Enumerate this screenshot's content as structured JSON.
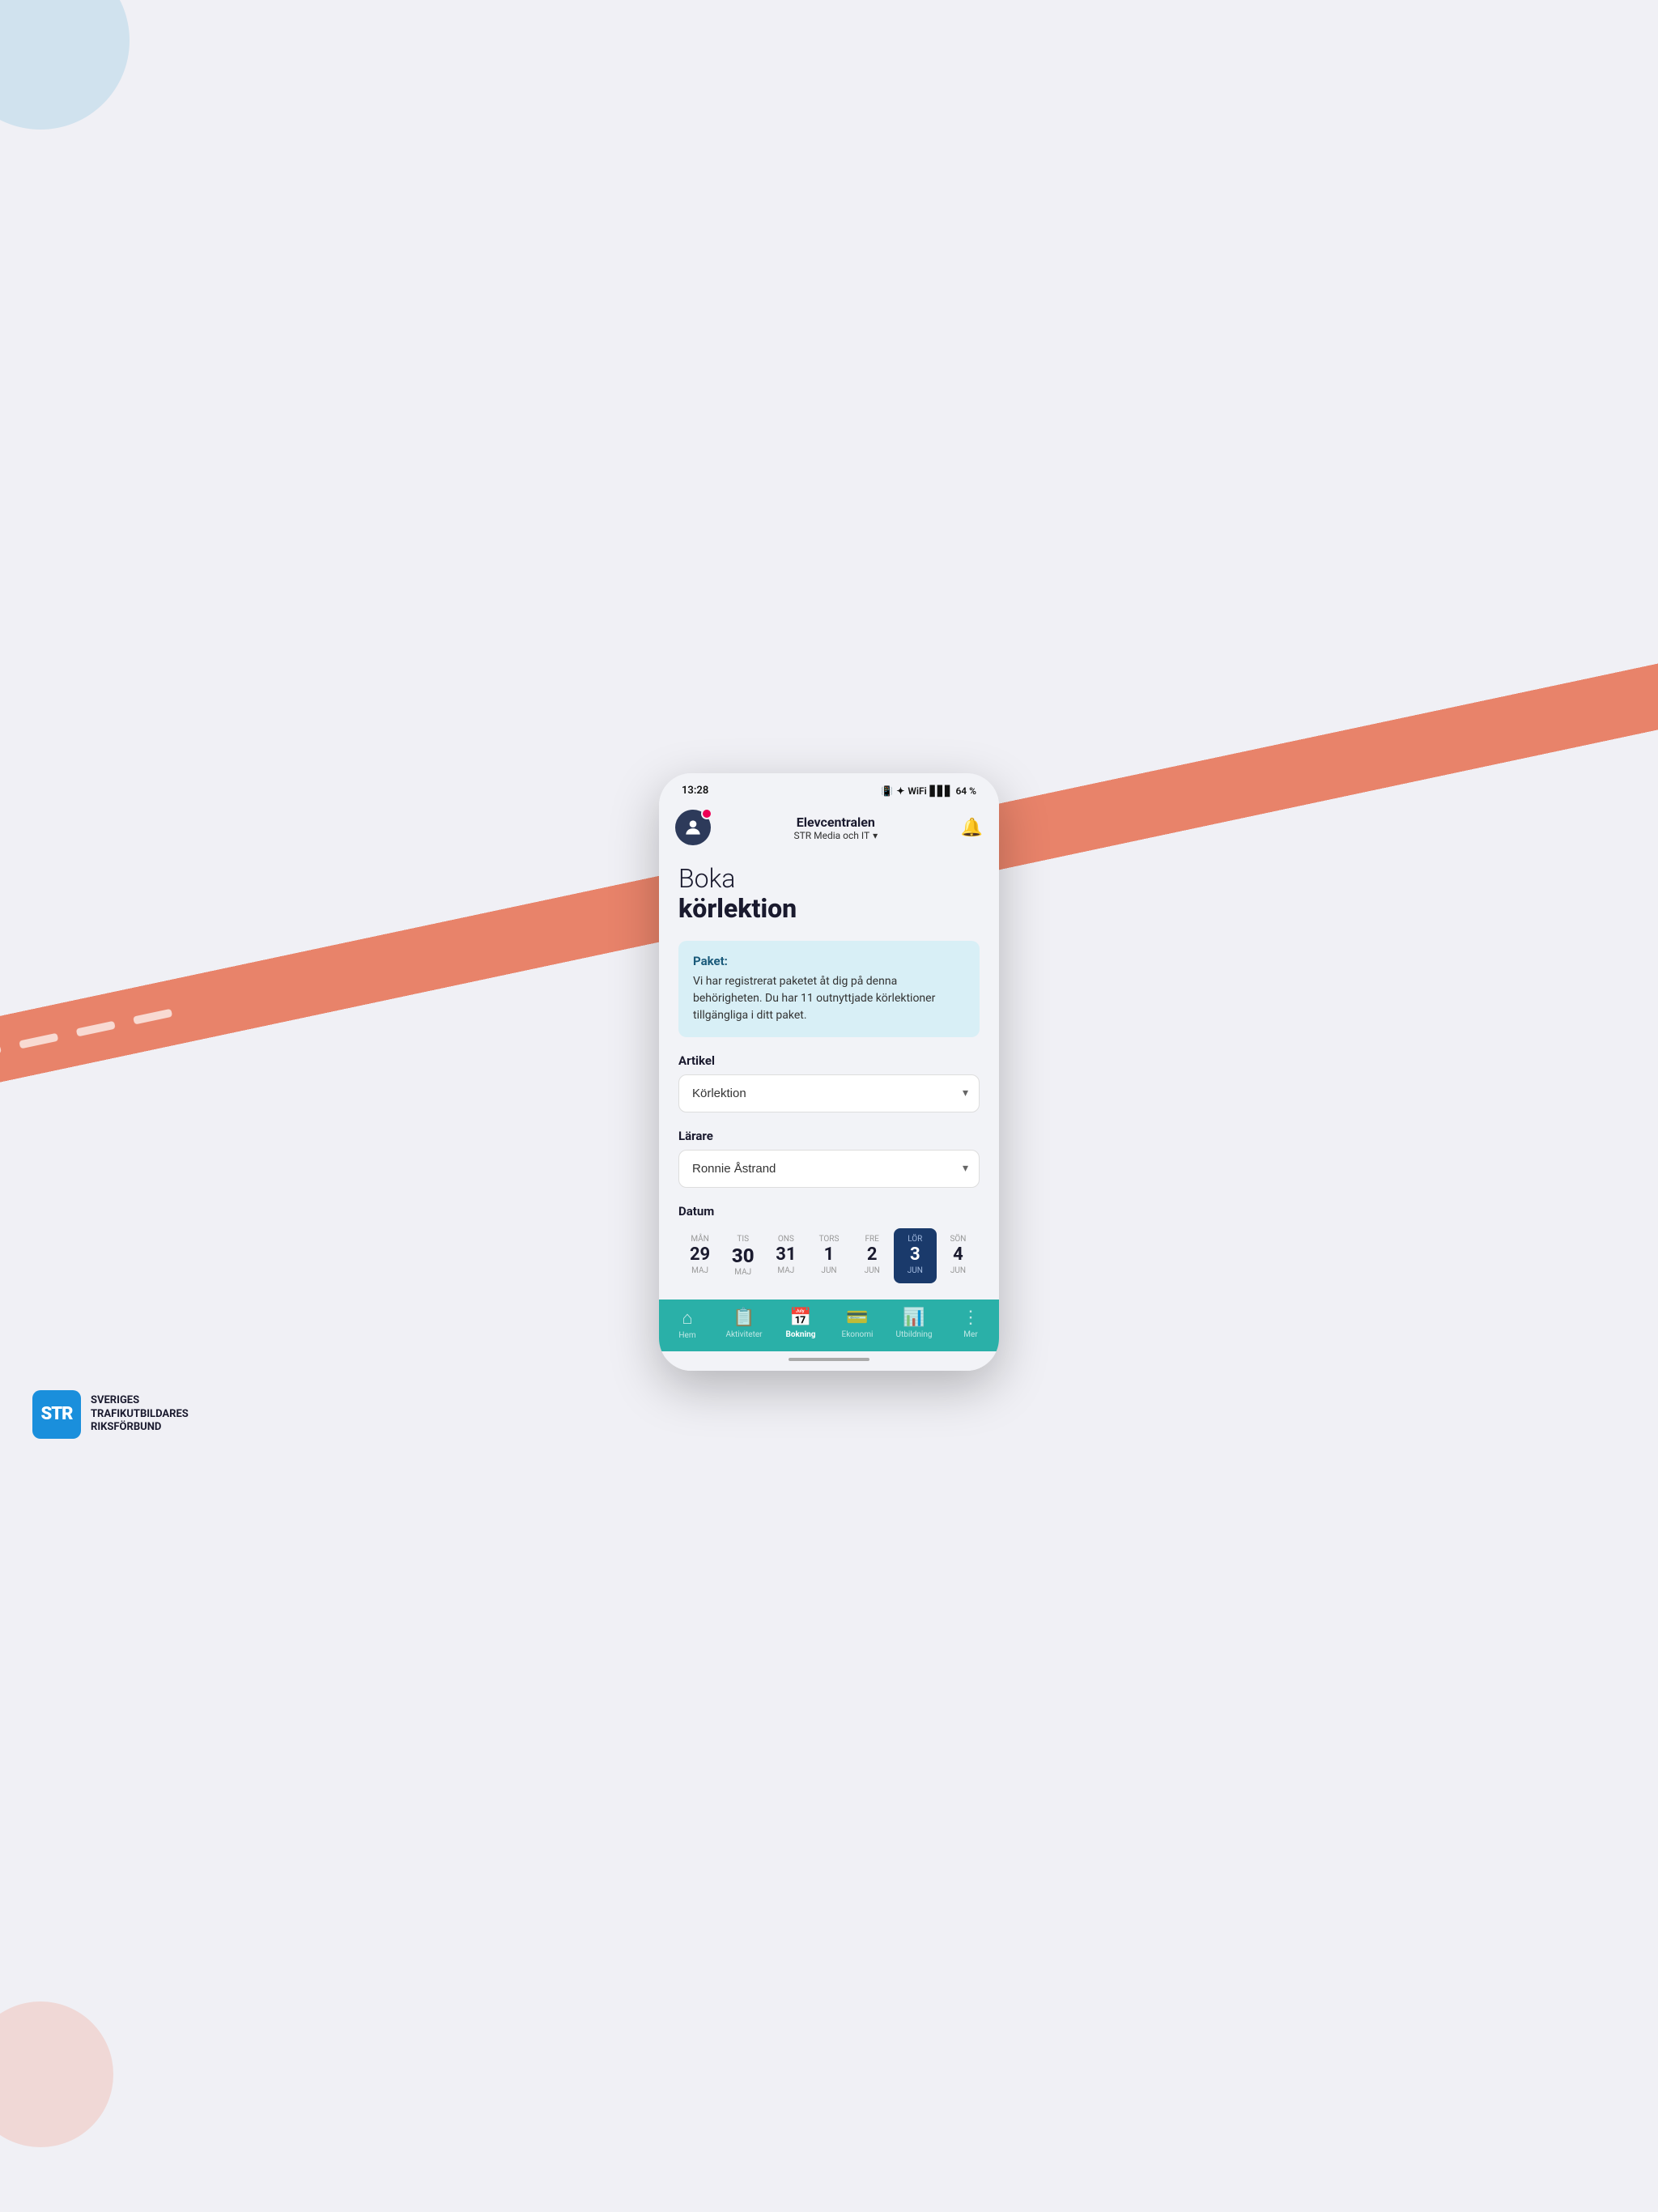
{
  "status_bar": {
    "time": "13:28",
    "battery": "64 %",
    "icons": "🔇 ✦ ⟳ ▋▋▋ 🔋"
  },
  "header": {
    "app_name": "Elevcentralen",
    "subtitle": "STR Media och IT",
    "chevron": "▾"
  },
  "page": {
    "title_light": "Boka",
    "title_bold": "körlektion"
  },
  "info_box": {
    "title": "Paket:",
    "text": "Vi har registrerat paketet åt dig på denna behörigheten. Du har 11 outnyttjade körlektioner tillgängliga i ditt paket."
  },
  "form": {
    "artikel_label": "Artikel",
    "artikel_value": "Körlektion",
    "larare_label": "Lärare",
    "larare_value": "Ronnie Åstrand",
    "datum_label": "Datum"
  },
  "dates": [
    {
      "day": "MÅN",
      "number": "29",
      "month": "MAJ",
      "active": false,
      "highlighted": false
    },
    {
      "day": "TIS",
      "number": "30",
      "month": "MAJ",
      "active": false,
      "highlighted": true
    },
    {
      "day": "ONS",
      "number": "31",
      "month": "MAJ",
      "active": false,
      "highlighted": false
    },
    {
      "day": "TORS",
      "number": "1",
      "month": "JUN",
      "active": false,
      "highlighted": false
    },
    {
      "day": "FRE",
      "number": "2",
      "month": "JUN",
      "active": false,
      "highlighted": false
    },
    {
      "day": "LÖR",
      "number": "3",
      "month": "JUN",
      "active": true,
      "highlighted": false
    },
    {
      "day": "SÖN",
      "number": "4",
      "month": "JUN",
      "active": false,
      "highlighted": false
    }
  ],
  "bottom_nav": [
    {
      "label": "Hem",
      "icon": "⌂",
      "active": false
    },
    {
      "label": "Aktiviteter",
      "icon": "📋",
      "active": false
    },
    {
      "label": "Bokning",
      "icon": "📅",
      "active": true
    },
    {
      "label": "Ekonomi",
      "icon": "💳",
      "active": false
    },
    {
      "label": "Utbildning",
      "icon": "📊",
      "active": false
    },
    {
      "label": "Mer",
      "icon": "⋮",
      "active": false
    }
  ],
  "str_logo": {
    "text": "STR",
    "line1": "SVERIGES",
    "line2": "TRAFIKUTBILDARES",
    "line3": "RIKSFÖRBUND"
  }
}
